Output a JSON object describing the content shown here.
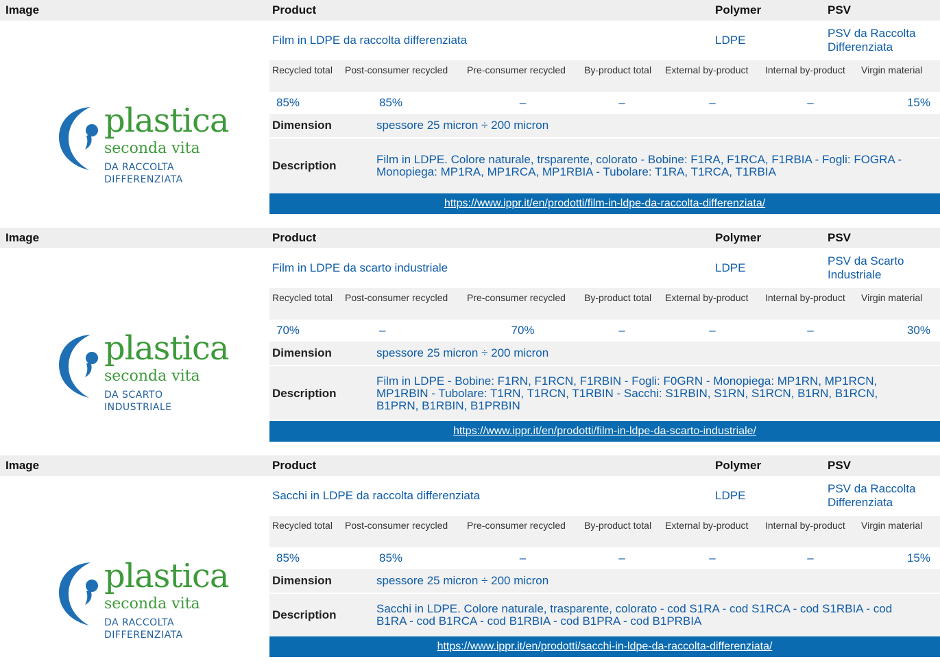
{
  "headers": {
    "image": "Image",
    "product": "Product",
    "polymer": "Polymer",
    "psv": "PSV"
  },
  "percent_headers": {
    "h1": "Recycled total",
    "h2": "Post-consumer recycled",
    "h3": "Pre-consumer recycled",
    "h4": "By-product total",
    "h5": "External by-product",
    "h6": "Internal by-product",
    "h7": "Virgin material"
  },
  "labels": {
    "dimension": "Dimension",
    "description": "Description"
  },
  "colors": {
    "link_blue": "#0e5ca8",
    "url_bar": "#0a6bb0",
    "logo_green": "#3d9a3a",
    "logo_blue": "#1f5f9e"
  },
  "products": [
    {
      "name": "Film in LDPE da raccolta differenziata",
      "polymer": "LDPE",
      "psv": "PSV da Raccolta Differenziata",
      "recycled_total": "85%",
      "post_consumer": "85%",
      "pre_consumer": "–",
      "byproduct_total": "–",
      "external_byproduct": "–",
      "internal_byproduct": "–",
      "virgin": "15%",
      "dimension": "spessore 25 micron ÷ 200 micron",
      "description": "Film in LDPE. Colore naturale, trsparente, colorato - Bobine: F1RA, F1RCA, F1RBIA - Fogli: FOGRA - Monopiega: MP1RA, MP1RCA, MP1RBIA - Tubolare: T1RA, T1RCA, T1RBIA",
      "url": "https://www.ippr.it/en/prodotti/film-in-ldpe-da-raccolta-differenziata/",
      "logo": {
        "word": "plastica",
        "sub": "seconda vita",
        "line1": "DA RACCOLTA",
        "line2": "DIFFERENZIATA"
      }
    },
    {
      "name": "Film in LDPE da scarto industriale",
      "polymer": "LDPE",
      "psv": "PSV da Scarto Industriale",
      "recycled_total": "70%",
      "post_consumer": "–",
      "pre_consumer": "70%",
      "byproduct_total": "–",
      "external_byproduct": "–",
      "internal_byproduct": "–",
      "virgin": "30%",
      "dimension": "spessore 25 micron ÷ 200 micron",
      "description": "Film in LDPE - Bobine: F1RN, F1RCN, F1RBIN - Fogli: F0GRN - Monopiega: MP1RN, MP1RCN, MP1RBIN - Tubolare: T1RN, T1RCN, T1RBIN - Sacchi: S1RBIN, S1RN, S1RCN, B1RN, B1RCN, B1PRN, B1RBIN, B1PRBIN",
      "url": "https://www.ippr.it/en/prodotti/film-in-ldpe-da-scarto-industriale/",
      "logo": {
        "word": "plastica",
        "sub": "seconda vita",
        "line1": "DA SCARTO",
        "line2": "INDUSTRIALE"
      }
    },
    {
      "name": "Sacchi in LDPE da raccolta differenziata",
      "polymer": "LDPE",
      "psv": "PSV da Raccolta Differenziata",
      "recycled_total": "85%",
      "post_consumer": "85%",
      "pre_consumer": "–",
      "byproduct_total": "–",
      "external_byproduct": "–",
      "internal_byproduct": "–",
      "virgin": "15%",
      "dimension": "spessore 25 micron ÷ 200 micron",
      "description": "Sacchi in LDPE. Colore naturale, trasparente, colorato - cod S1RA - cod S1RCA - cod S1RBIA - cod B1RA - cod B1RCA - cod B1RBIA - cod B1PRA - cod B1PRBIA",
      "url": "https://www.ippr.it/en/prodotti/sacchi-in-ldpe-da-raccolta-differenziata/",
      "logo": {
        "word": "plastica",
        "sub": "seconda vita",
        "line1": "DA RACCOLTA",
        "line2": "DIFFERENZIATA"
      }
    }
  ]
}
